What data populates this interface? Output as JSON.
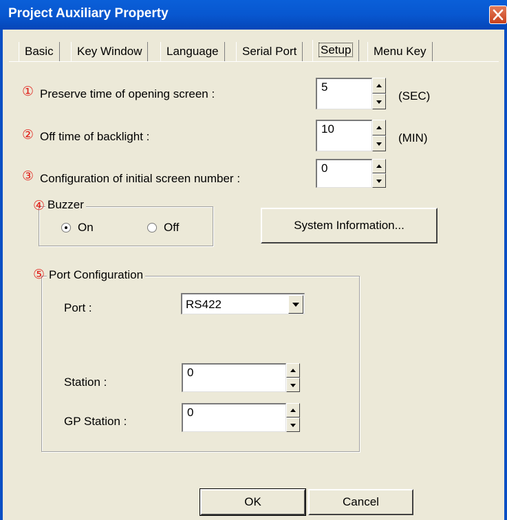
{
  "window": {
    "title": "Project Auxiliary Property"
  },
  "tabs": [
    {
      "label": "Basic",
      "active": false
    },
    {
      "label": "Key Window",
      "active": false
    },
    {
      "label": "Language",
      "active": false
    },
    {
      "label": "Serial Port",
      "active": false
    },
    {
      "label": "Setup",
      "active": true
    },
    {
      "label": "Menu Key",
      "active": false
    }
  ],
  "setup": {
    "opening_screen": {
      "num": "①",
      "label": "Preserve time of opening screen  :",
      "value": "5",
      "unit": "(SEC)"
    },
    "backlight": {
      "num": "②",
      "label": "Off time of backlight  :",
      "value": "10",
      "unit": "(MIN)"
    },
    "initial_screen": {
      "num": "③",
      "label": "Configuration of initial screen number  :",
      "value": "0"
    },
    "buzzer": {
      "num": "④",
      "title": "Buzzer",
      "on_label": "On",
      "off_label": "Off",
      "selected": "On"
    },
    "system_info_label": "System Information...",
    "port_config": {
      "num": "⑤",
      "title": "Port Configuration",
      "port_label": "Port :",
      "port_value": "RS422",
      "station_label": "Station :",
      "station_value": "0",
      "gp_station_label": "GP Station :",
      "gp_station_value": "0"
    }
  },
  "footer": {
    "ok_label": "OK",
    "cancel_label": "Cancel"
  },
  "colors": {
    "titlebar": "#0857d0",
    "dialog_bg": "#ece9d8",
    "circled_number": "#e0201a"
  }
}
